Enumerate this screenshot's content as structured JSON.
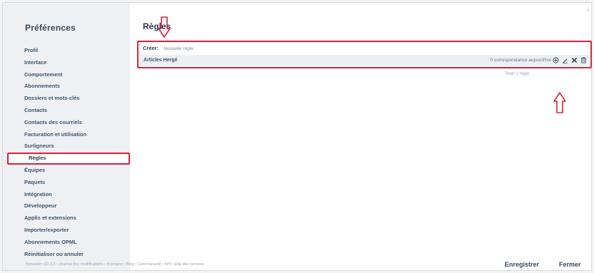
{
  "sidebar": {
    "title": "Préférences",
    "items": [
      {
        "label": "Profil"
      },
      {
        "label": "Interface"
      },
      {
        "label": "Comportement"
      },
      {
        "label": "Abonnements"
      },
      {
        "label": "Dossiers et mots-clés"
      },
      {
        "label": "Contacts"
      },
      {
        "label": "Contacts des courriels"
      },
      {
        "label": "Facturation et utilisation"
      },
      {
        "label": "Surligneurs"
      },
      {
        "label": "Règles",
        "active": true
      },
      {
        "label": "Équipes"
      },
      {
        "label": "Paquets"
      },
      {
        "label": "Intégration"
      },
      {
        "label": "Développeur"
      },
      {
        "label": "Applis et extensions"
      },
      {
        "label": "Importer/exporter"
      },
      {
        "label": "Abonnements OPML"
      },
      {
        "label": "Réinitialiser ou annuler"
      }
    ]
  },
  "main": {
    "title": "Règles",
    "create_label": "Créer:",
    "create_link": "Nouvelle règle",
    "rules": [
      {
        "name": "Articles Hergé",
        "matches": "0 correspondance aujourd'hui"
      }
    ],
    "total": "Total: 1 règle",
    "close_glyph": "×"
  },
  "icons": {
    "add": "plus-circle-icon",
    "edit": "pencil-icon",
    "delete": "x-icon",
    "trash": "trash-icon",
    "annotation_arrows": "red-outline-arrow-icon"
  },
  "colors": {
    "highlight": "#d9233a",
    "sidebar_bg": "#eef0f3",
    "text_primary": "#3f5570"
  },
  "footer": {
    "links": "Inoreader v11.3.2 • Journal des modifications • À propos • Blog • Communauté • API • État des services",
    "save_label": "Enregistrer",
    "close_label": "Fermer"
  }
}
